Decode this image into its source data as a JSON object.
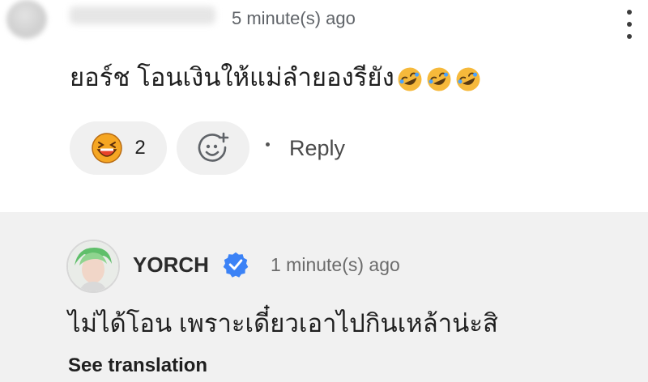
{
  "top_comment": {
    "time": "5 minute(s) ago",
    "text": "ยอร์ช โอนเงินให้แม่ลำยองรียัง",
    "trailing_emoji": [
      "rofl-emoji",
      "rofl-emoji",
      "rofl-emoji"
    ],
    "reaction": {
      "icon": "laughing-face-icon",
      "count": "2"
    },
    "add_reaction_icon": "add-reaction-icon",
    "reply_label": "Reply"
  },
  "reply": {
    "username": "YORCH",
    "verified_icon": "verified-badge-icon",
    "time": "1 minute(s) ago",
    "text": "ไม่ได้โอน เพราะเดี๋ยวเอาไปกินเหล้าน่ะสิ",
    "see_translation": "See translation"
  },
  "colors": {
    "reply_panel_bg": "#f1f1f1",
    "pill_bg": "#f0f0f0",
    "verified_blue": "#3b82f6",
    "emoji_yellow": "#f6b93b"
  }
}
